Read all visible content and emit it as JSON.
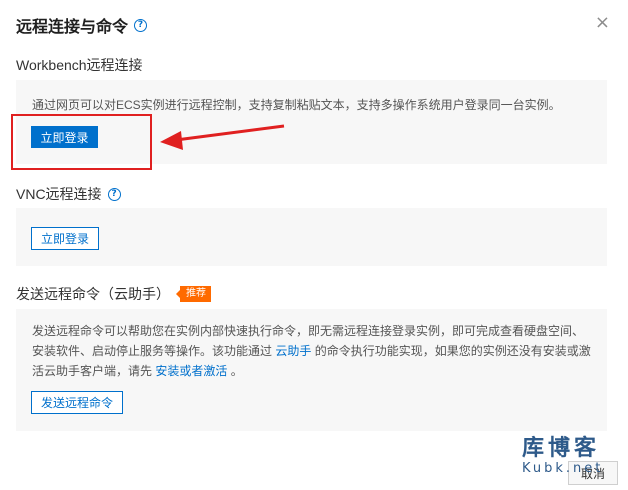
{
  "dialog": {
    "title": "远程连接与命令",
    "help_glyph": "?",
    "close_glyph": "×"
  },
  "workbench": {
    "title": "Workbench远程连接",
    "description": "通过网页可以对ECS实例进行远程控制，支持复制粘贴文本，支持多操作系统用户登录同一台实例。",
    "login_label": "立即登录"
  },
  "vnc": {
    "title": "VNC远程连接",
    "help_glyph": "?",
    "login_label": "立即登录"
  },
  "command": {
    "title": "发送远程命令（云助手）",
    "badge": "推荐",
    "desc_part1": "发送远程命令可以帮助您在实例内部快速执行命令，即无需远程连接登录实例，即可完成查看硬盘空间、安装软件、启动停止服务等操作。该功能通过",
    "link_cloud_assistant": "云助手",
    "desc_part2": "的命令执行功能实现，如果您的实例还没有安装或激活云助手客户端，请先",
    "link_install": "安装或者激活",
    "desc_part3": "。",
    "send_label": "发送远程命令"
  },
  "footer": {
    "cancel_label": "取消"
  },
  "watermark": {
    "line1": "库博客",
    "line2": "Kubk.net"
  },
  "colors": {
    "primary": "#0070cc",
    "annotation_red": "#e02020",
    "badge_orange": "#ff6a00",
    "panel_bg": "#f7f7f7"
  }
}
